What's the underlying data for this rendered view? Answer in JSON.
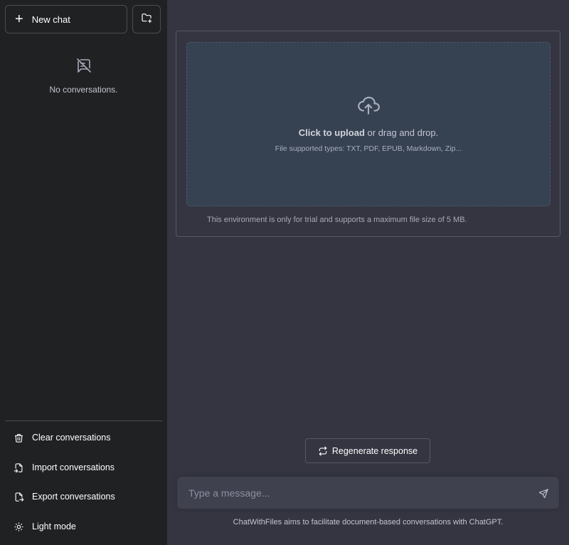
{
  "sidebar": {
    "new_chat_label": "New chat",
    "new_chat_icon": "plus-icon",
    "new_folder_icon": "folder-plus-icon",
    "empty_icon": "no-messages-icon",
    "empty_label": "No conversations.",
    "items": [
      {
        "label": "Clear conversations",
        "icon": "trash-icon"
      },
      {
        "label": "Import conversations",
        "icon": "file-import-icon"
      },
      {
        "label": "Export conversations",
        "icon": "file-export-icon"
      },
      {
        "label": "Light mode",
        "icon": "sun-icon"
      }
    ]
  },
  "upload": {
    "icon": "cloud-upload-icon",
    "click_label": "Click to upload",
    "drag_label": " or drag and drop.",
    "supported_types": "File supported types: TXT, PDF, EPUB, Markdown, Zip...",
    "trial_note": "This environment is only for trial and supports a maximum file size of 5 MB."
  },
  "regenerate": {
    "label": "Regenerate response",
    "icon": "refresh-icon"
  },
  "composer": {
    "placeholder": "Type a message...",
    "value": "",
    "send_icon": "send-icon"
  },
  "footer": {
    "note": "ChatWithFiles aims to facilitate document-based conversations with ChatGPT."
  },
  "colors": {
    "sidebar_bg": "#202123",
    "main_bg": "#343541",
    "dropzone_bg": "#364152",
    "input_bg": "#40414f",
    "border": "#565869"
  }
}
